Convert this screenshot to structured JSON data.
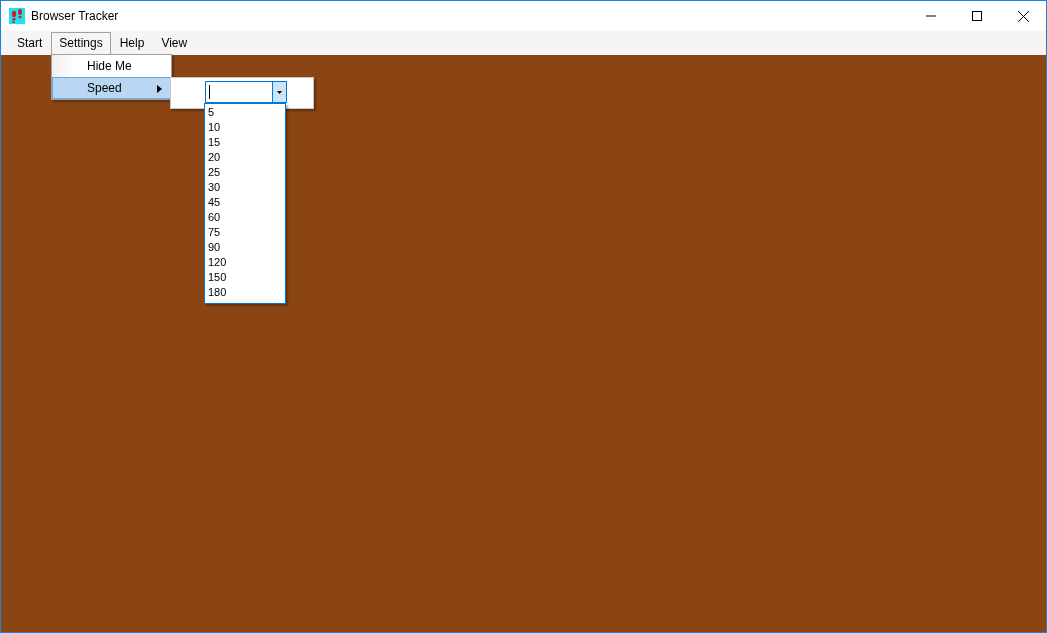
{
  "window": {
    "title": "Browser Tracker"
  },
  "menu_bar": [
    {
      "label": "Start",
      "selected": false
    },
    {
      "label": "Settings",
      "selected": true
    },
    {
      "label": "Help",
      "selected": false
    },
    {
      "label": "View",
      "selected": false
    }
  ],
  "settings_menu": {
    "items": [
      {
        "label": "Hide Me",
        "selected": false,
        "has_submenu": false
      },
      {
        "label": "Speed",
        "selected": true,
        "has_submenu": true
      }
    ]
  },
  "speed_submenu": {
    "combo": {
      "expanded": true,
      "options": [
        {
          "label": "5",
          "selected": false
        },
        {
          "label": "10",
          "selected": false
        },
        {
          "label": "15",
          "selected": false
        },
        {
          "label": "20",
          "selected": false
        },
        {
          "label": "25",
          "selected": false
        },
        {
          "label": "30",
          "selected": false
        },
        {
          "label": "45",
          "selected": false
        },
        {
          "label": "60",
          "selected": false
        },
        {
          "label": "75",
          "selected": false
        },
        {
          "label": "90",
          "selected": false
        },
        {
          "label": "120",
          "selected": false
        },
        {
          "label": "150",
          "selected": false
        },
        {
          "label": "180",
          "selected": false
        }
      ]
    }
  }
}
